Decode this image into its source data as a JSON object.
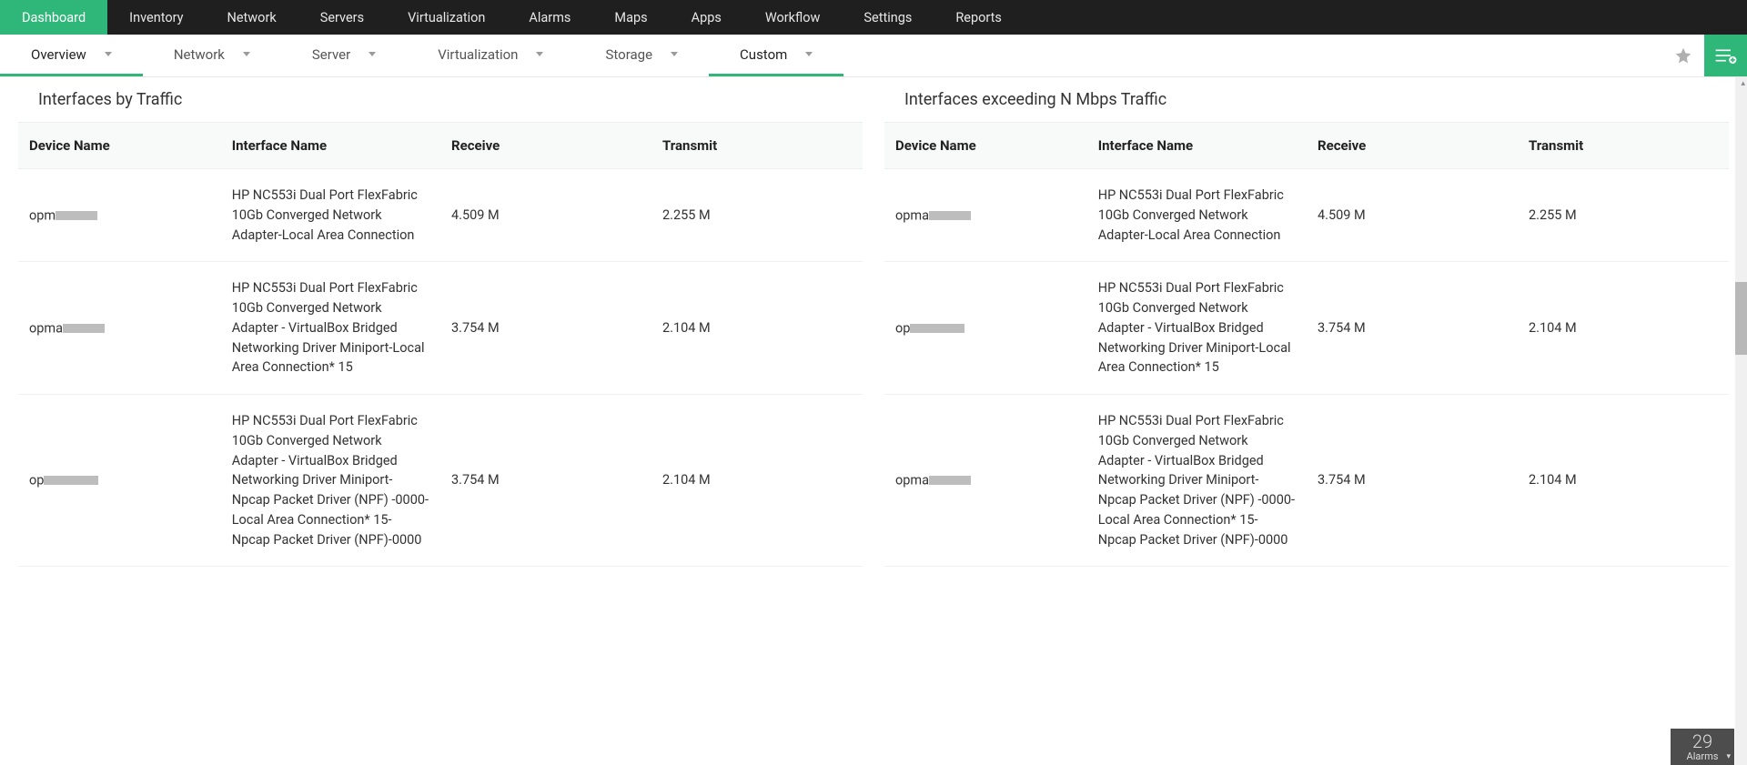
{
  "topnav": [
    {
      "label": "Dashboard",
      "active": true
    },
    {
      "label": "Inventory"
    },
    {
      "label": "Network"
    },
    {
      "label": "Servers"
    },
    {
      "label": "Virtualization"
    },
    {
      "label": "Alarms"
    },
    {
      "label": "Maps"
    },
    {
      "label": "Apps"
    },
    {
      "label": "Workflow"
    },
    {
      "label": "Settings"
    },
    {
      "label": "Reports"
    }
  ],
  "subnav": [
    {
      "label": "Overview",
      "active": true
    },
    {
      "label": "Network"
    },
    {
      "label": "Server"
    },
    {
      "label": "Virtualization"
    },
    {
      "label": "Storage"
    },
    {
      "label": "Custom",
      "active": true
    }
  ],
  "panels": {
    "left": {
      "title": "Interfaces by Traffic",
      "columns": [
        "Device Name",
        "Interface Name",
        "Receive",
        "Transmit"
      ],
      "rows": [
        {
          "device_prefix": "opm",
          "interface": "HP NC553i Dual Port FlexFabric 10Gb Converged Network Adapter-Local Area Connection",
          "receive": "4.509 M",
          "transmit": "2.255 M"
        },
        {
          "device_prefix": "opma",
          "interface": "HP NC553i Dual Port FlexFabric 10Gb Converged Network Adapter - VirtualBox Bridged Networking Driver Miniport-Local Area Connection* 15",
          "receive": "3.754 M",
          "transmit": "2.104 M"
        },
        {
          "device_prefix": "op",
          "interface": "HP NC553i Dual Port FlexFabric 10Gb Converged Network Adapter - VirtualBox Bridged Networking Driver Miniport-Npcap Packet Driver (NPF) -0000-Local Area Connection* 15-Npcap Packet Driver (NPF)-0000",
          "receive": "3.754 M",
          "transmit": "2.104 M"
        }
      ]
    },
    "right": {
      "title": "Interfaces exceeding N Mbps Traffic",
      "columns": [
        "Device Name",
        "Interface Name",
        "Receive",
        "Transmit"
      ],
      "rows": [
        {
          "device_prefix": "opma",
          "interface": "HP NC553i Dual Port FlexFabric 10Gb Converged Network Adapter-Local Area Connection",
          "receive": "4.509 M",
          "transmit": "2.255 M"
        },
        {
          "device_prefix": "op",
          "interface": "HP NC553i Dual Port FlexFabric 10Gb Converged Network Adapter - VirtualBox Bridged Networking Driver Miniport-Local Area Connection* 15",
          "receive": "3.754 M",
          "transmit": "2.104 M"
        },
        {
          "device_prefix": "opma",
          "interface": "HP NC553i Dual Port FlexFabric 10Gb Converged Network Adapter - VirtualBox Bridged Networking Driver Miniport-Npcap Packet Driver (NPF) -0000-Local Area Connection* 15-Npcap Packet Driver (NPF)-0000",
          "receive": "3.754 M",
          "transmit": "2.104 M"
        }
      ]
    }
  },
  "alarms": {
    "count": "29",
    "label": "Alarms"
  }
}
